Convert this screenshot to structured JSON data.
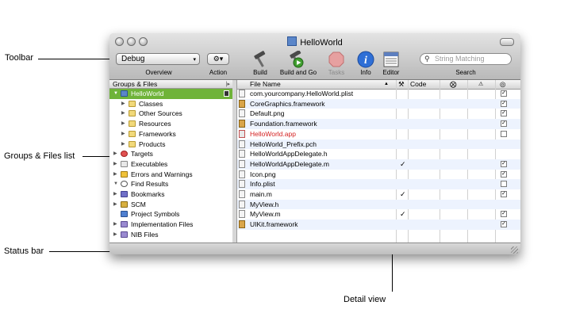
{
  "callouts": {
    "toolbar": "Toolbar",
    "groups_files": "Groups & Files list",
    "status_bar": "Status bar",
    "detail_view": "Detail view"
  },
  "window": {
    "title": "HelloWorld"
  },
  "toolbar": {
    "config_value": "Debug",
    "overview_label": "Overview",
    "action_label": "Action",
    "build_label": "Build",
    "build_go_label": "Build and Go",
    "tasks_label": "Tasks",
    "info_label": "Info",
    "editor_label": "Editor",
    "search_label": "Search",
    "search_placeholder": "String Matching"
  },
  "sidebar": {
    "header": "Groups & Files",
    "items": [
      {
        "label": "HelloWorld",
        "expanded": true,
        "selected": true
      },
      {
        "label": "Classes"
      },
      {
        "label": "Other Sources"
      },
      {
        "label": "Resources"
      },
      {
        "label": "Frameworks"
      },
      {
        "label": "Products"
      },
      {
        "label": "Targets"
      },
      {
        "label": "Executables"
      },
      {
        "label": "Errors and Warnings"
      },
      {
        "label": "Find Results",
        "expanded": true
      },
      {
        "label": "Bookmarks"
      },
      {
        "label": "SCM"
      },
      {
        "label": "Project Symbols"
      },
      {
        "label": "Implementation Files"
      },
      {
        "label": "NIB Files"
      }
    ]
  },
  "detail": {
    "columns": {
      "file_name": "File Name",
      "code": "Code"
    },
    "rows": [
      {
        "name": "com.yourcompany.HelloWorld.plist",
        "built": false,
        "target": true
      },
      {
        "name": "CoreGraphics.framework",
        "built": false,
        "target": true
      },
      {
        "name": "Default.png",
        "built": false,
        "target": true
      },
      {
        "name": "Foundation.framework",
        "built": false,
        "target": true
      },
      {
        "name": "HelloWorld.app",
        "built": false,
        "target": false
      },
      {
        "name": "HelloWorld_Prefix.pch",
        "built": false,
        "target": null
      },
      {
        "name": "HelloWorldAppDelegate.h",
        "built": false,
        "target": null
      },
      {
        "name": "HelloWorldAppDelegate.m",
        "built": true,
        "target": true
      },
      {
        "name": "Icon.png",
        "built": false,
        "target": true
      },
      {
        "name": "Info.plist",
        "built": false,
        "target": false
      },
      {
        "name": "main.m",
        "built": true,
        "target": true
      },
      {
        "name": "MyView.h",
        "built": false,
        "target": null
      },
      {
        "name": "MyView.m",
        "built": true,
        "target": true
      },
      {
        "name": "UIKit.framework",
        "built": false,
        "target": true
      }
    ]
  },
  "glyphs": {
    "check": "✓",
    "box_check": "✓",
    "search_glyph": "🔍",
    "gear": "⚙▾",
    "popup_arrow": "▾",
    "tri_open": "▼",
    "tri_closed": "▶"
  }
}
